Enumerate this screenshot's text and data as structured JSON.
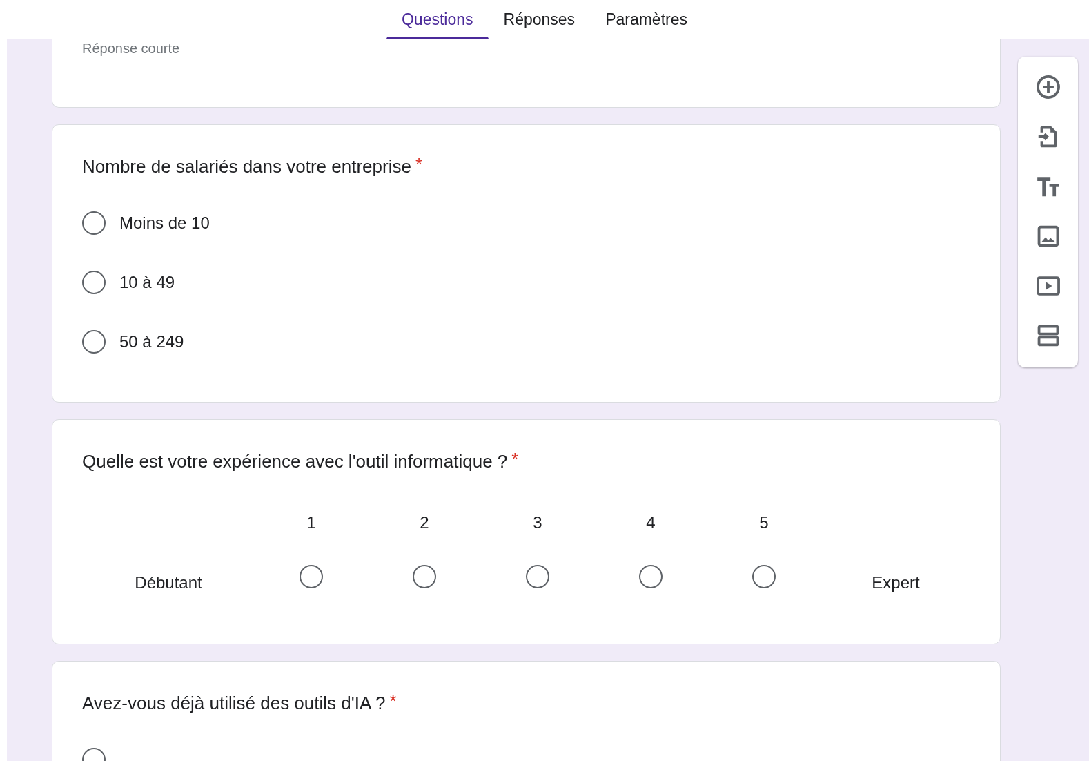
{
  "tabs": [
    {
      "label": "Questions",
      "selected": true
    },
    {
      "label": "Réponses",
      "selected": false
    },
    {
      "label": "Paramètres",
      "selected": false
    }
  ],
  "questions": [
    {
      "kind": "short_answer",
      "answer_hint": "Réponse courte"
    },
    {
      "kind": "choice",
      "title": "Nombre de salariés dans votre entreprise",
      "required_mark": "*",
      "options": [
        {
          "label": "Moins de 10",
          "selected": false
        },
        {
          "label": "10 à 49",
          "selected": false
        },
        {
          "label": "50 à 249",
          "selected": false
        }
      ]
    },
    {
      "kind": "scale",
      "title": "Quelle est votre expérience avec l'outil informatique ?",
      "required_mark": "*",
      "low_label": "Débutant",
      "high_label": "Expert",
      "points": [
        {
          "label": "1",
          "selected": false
        },
        {
          "label": "2",
          "selected": false
        },
        {
          "label": "3",
          "selected": false
        },
        {
          "label": "4",
          "selected": false
        },
        {
          "label": "5",
          "selected": false
        }
      ]
    },
    {
      "kind": "choice",
      "title": "Avez-vous déjà utilisé des outils d'IA ?",
      "required_mark": "*",
      "options": [
        {
          "selected": false
        }
      ]
    }
  ]
}
